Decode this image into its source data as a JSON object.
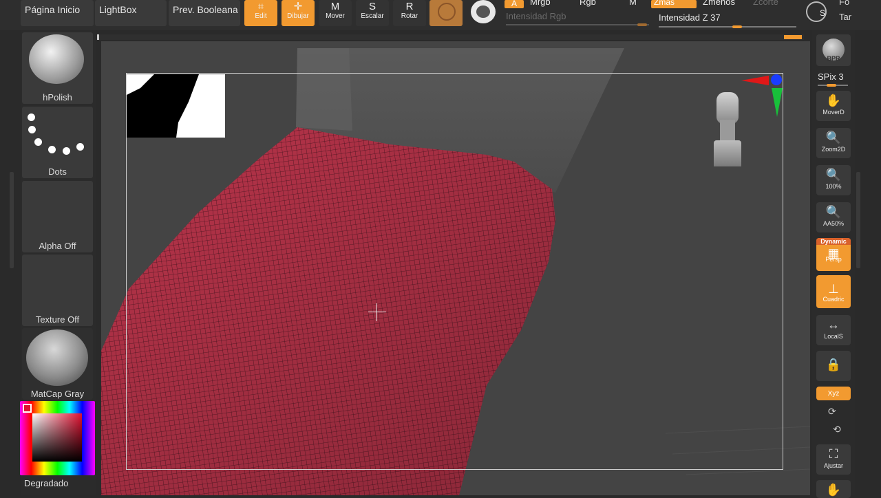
{
  "menu": {
    "home": "Página Inicio",
    "lightbox": "LightBox",
    "boolean": "Prev. Booleana"
  },
  "tools": [
    {
      "label": "Edit",
      "icon": "edit-icon"
    },
    {
      "label": "Dibujar",
      "icon": "draw-icon"
    },
    {
      "label": "Mover",
      "icon": "move-icon"
    },
    {
      "label": "Escalar",
      "icon": "scale-icon"
    },
    {
      "label": "Rotar",
      "icon": "rotate-icon"
    }
  ],
  "tools_letters": {
    "move": "M",
    "scale": "S",
    "rotate": "R"
  },
  "channels": {
    "a": "A",
    "mrgb": "Mrgb",
    "rgb": "Rgb",
    "m": "M",
    "zmas": "Zmas",
    "zmenos": "Zmenos",
    "zcorte": "Zcorte",
    "rgb_intensity": "Intensidad Rgb",
    "z_intensity_label": "Intensidad Z",
    "z_intensity_value": "37",
    "z_intensity_level": 0.37,
    "right_top": "Fo",
    "right_bottom": "Tar",
    "s_symbol": "S"
  },
  "left_panel": {
    "brush": "hPolish",
    "stroke": "Dots",
    "alpha": "Alpha Off",
    "texture": "Texture Off",
    "material": "MatCap Gray",
    "gradient": "Degradado"
  },
  "right_panel": {
    "bpr": "BPR",
    "spix_label": "SPix",
    "spix_value": "3",
    "buttons": [
      {
        "label": "MoverD",
        "icon": "hand-icon"
      },
      {
        "label": "Zoom2D",
        "icon": "zoom-icon"
      },
      {
        "label": "100%",
        "icon": "zoom-100-icon"
      },
      {
        "label": "AA50%",
        "icon": "zoom-aa-icon"
      },
      {
        "label": "Persp",
        "icon": "perspective-icon",
        "badge": "Dynamic"
      },
      {
        "label": "Cuadric",
        "icon": "floor-icon"
      },
      {
        "label": "LocalS",
        "icon": "local-symmetry-icon"
      },
      {
        "label": "",
        "icon": "lock-icon"
      },
      {
        "label": "Xyz",
        "icon": "xyz-rotate-icon"
      },
      {
        "label": "Ajustar",
        "icon": "frame-icon"
      }
    ]
  },
  "colors": {
    "accent": "#f29a30",
    "mesh": "#b8344a",
    "viewport": "#444444"
  }
}
